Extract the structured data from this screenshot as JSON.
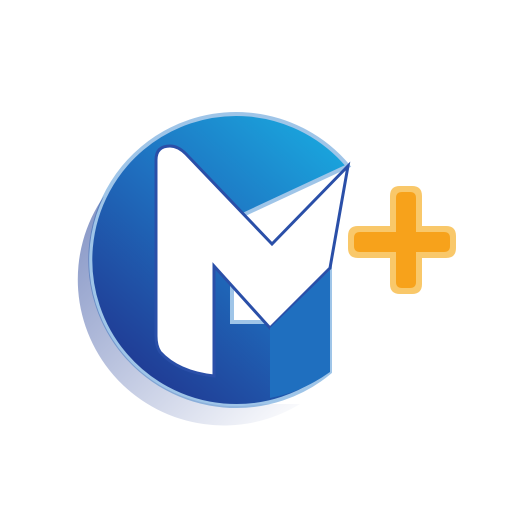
{
  "logo": {
    "name": "M plus app icon",
    "colors": {
      "background": "#ffffff",
      "blue_light": "#1aa3dc",
      "blue_mid": "#1f6fbf",
      "blue_dark": "#20358f",
      "blue_rim": "#9fc5e8",
      "letter": "#ffffff",
      "letter_outline": "#2a4fa8",
      "plus_fill": "#f7a21b",
      "plus_outline": "#f9c86a"
    },
    "icons": [
      "letter-m-icon",
      "plus-icon"
    ]
  }
}
